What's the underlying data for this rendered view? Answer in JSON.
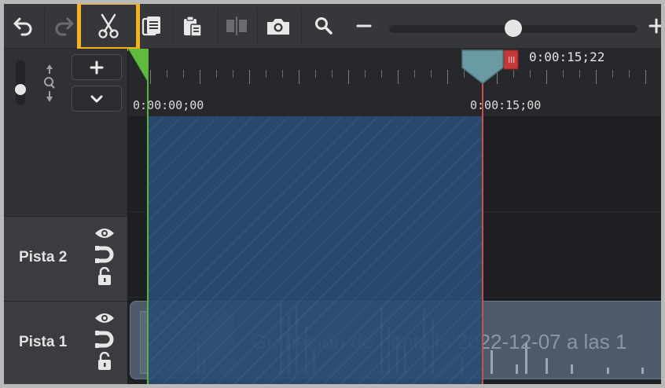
{
  "toolbar": {
    "buttons": [
      {
        "name": "undo-button",
        "icon": "undo-icon"
      },
      {
        "name": "redo-button",
        "icon": "redo-icon"
      },
      {
        "name": "cut-button",
        "icon": "scissors-icon",
        "highlighted": true
      },
      {
        "name": "copy-button",
        "icon": "copy-icon"
      },
      {
        "name": "paste-button",
        "icon": "paste-icon"
      },
      {
        "name": "split-button",
        "icon": "split-icon"
      },
      {
        "name": "snapshot-button",
        "icon": "camera-icon"
      },
      {
        "name": "zoom-search-button",
        "icon": "magnifier-icon"
      },
      {
        "name": "zoom-out-button",
        "icon": "minus-icon"
      },
      {
        "name": "zoom-in-button",
        "icon": "plus-icon"
      }
    ],
    "zoom_level_fraction": 0.5,
    "highlight_color": "#f6b21a"
  },
  "left_panel": {
    "add_track_icon": "plus-icon",
    "collapse_icon": "chevron-down-icon",
    "track_height_slider_fraction": 0.25
  },
  "ruler": {
    "start_label": "0:00:00;00",
    "mid_label": "0:00:15;00",
    "playhead_time": "0:00:15;22"
  },
  "tracks": [
    {
      "label": "Pista 2",
      "icons": [
        "eye-icon",
        "magnet-icon",
        "unlock-icon"
      ]
    },
    {
      "label": "Pista 1",
      "icons": [
        "eye-icon",
        "magnet-icon",
        "unlock-icon"
      ]
    }
  ],
  "clip": {
    "title": "Grabación de pantalla 2022-12-07 a las 1"
  },
  "colors": {
    "selection": "#2a4c73",
    "playhead": "#d24b4b",
    "in_marker": "#57b43a"
  }
}
